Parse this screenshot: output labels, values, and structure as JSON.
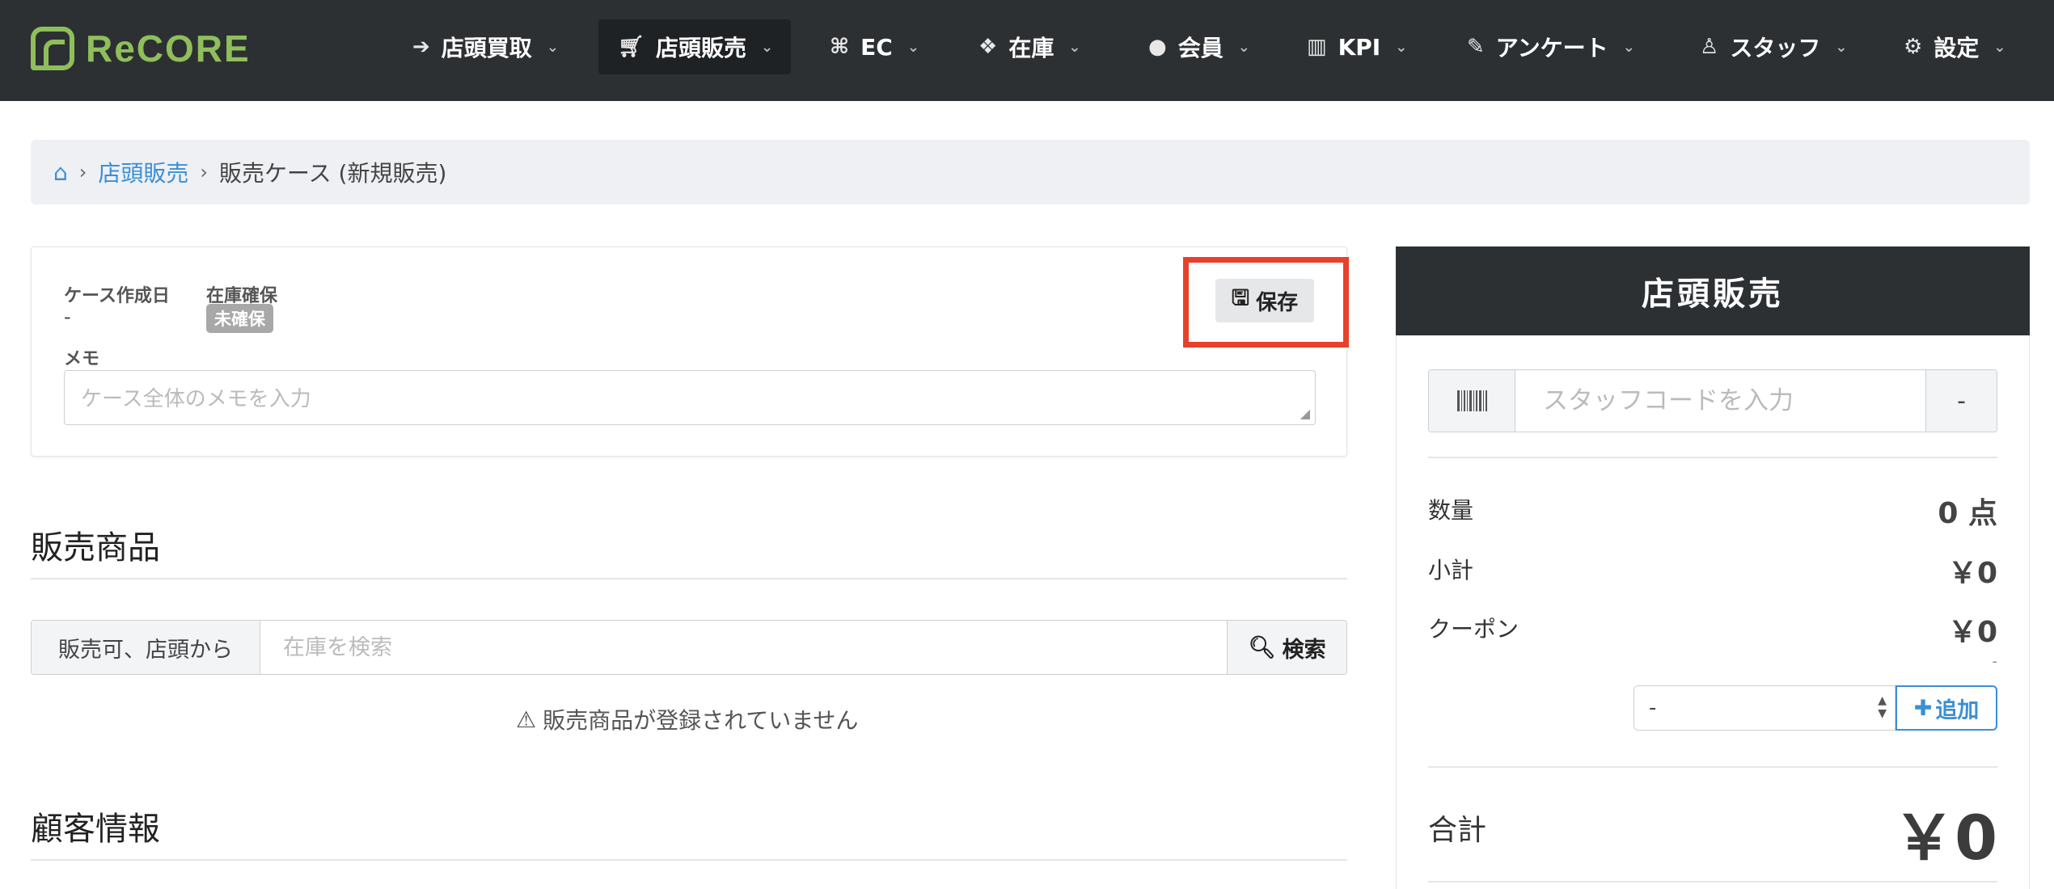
{
  "app": {
    "logo_text": "ReCORE"
  },
  "nav": {
    "items": [
      {
        "label": "店頭買取",
        "icon": "sign-in-icon"
      },
      {
        "label": "店頭販売",
        "icon": "cart-icon",
        "active": true
      },
      {
        "label": "EC",
        "icon": "sitemap-icon"
      },
      {
        "label": "在庫",
        "icon": "cubes-icon"
      },
      {
        "label": "会員",
        "icon": "user-icon"
      },
      {
        "label": "KPI",
        "icon": "bar-chart-icon"
      },
      {
        "label": "アンケート",
        "icon": "edit-icon"
      },
      {
        "label": "スタッフ",
        "icon": "staff-icon"
      },
      {
        "label": "設定",
        "icon": "gear-icon"
      }
    ]
  },
  "breadcrumb": {
    "link": "店頭販売",
    "current": "販売ケース (新規販売)"
  },
  "case": {
    "created_label": "ケース作成日",
    "created_value": "-",
    "stock_label": "在庫確保",
    "stock_badge": "未確保",
    "memo_label": "メモ",
    "memo_placeholder": "ケース全体のメモを入力",
    "save_label": "保存"
  },
  "products": {
    "title": "販売商品",
    "filter_label": "販売可、店頭から",
    "search_placeholder": "在庫を検索",
    "search_button": "検索",
    "empty_message": "販売商品が登録されていません"
  },
  "customer": {
    "title": "顧客情報"
  },
  "pos": {
    "title": "店頭販売",
    "staff_placeholder": "スタッフコードを入力",
    "staff_button": "-",
    "quantity_label": "数量",
    "quantity_value": "0 点",
    "subtotal_label": "小計",
    "subtotal_value": "￥0",
    "coupon_label": "クーポン",
    "coupon_value": "￥0",
    "coupon_note": "-",
    "coupon_select_value": "-",
    "add_button": "追加",
    "total_label": "合計",
    "total_value": "￥0"
  },
  "colors": {
    "nav_bg": "#2d3033",
    "brand": "#8fbf5a",
    "link": "#3a8fd6",
    "highlight": "#e8412b"
  }
}
